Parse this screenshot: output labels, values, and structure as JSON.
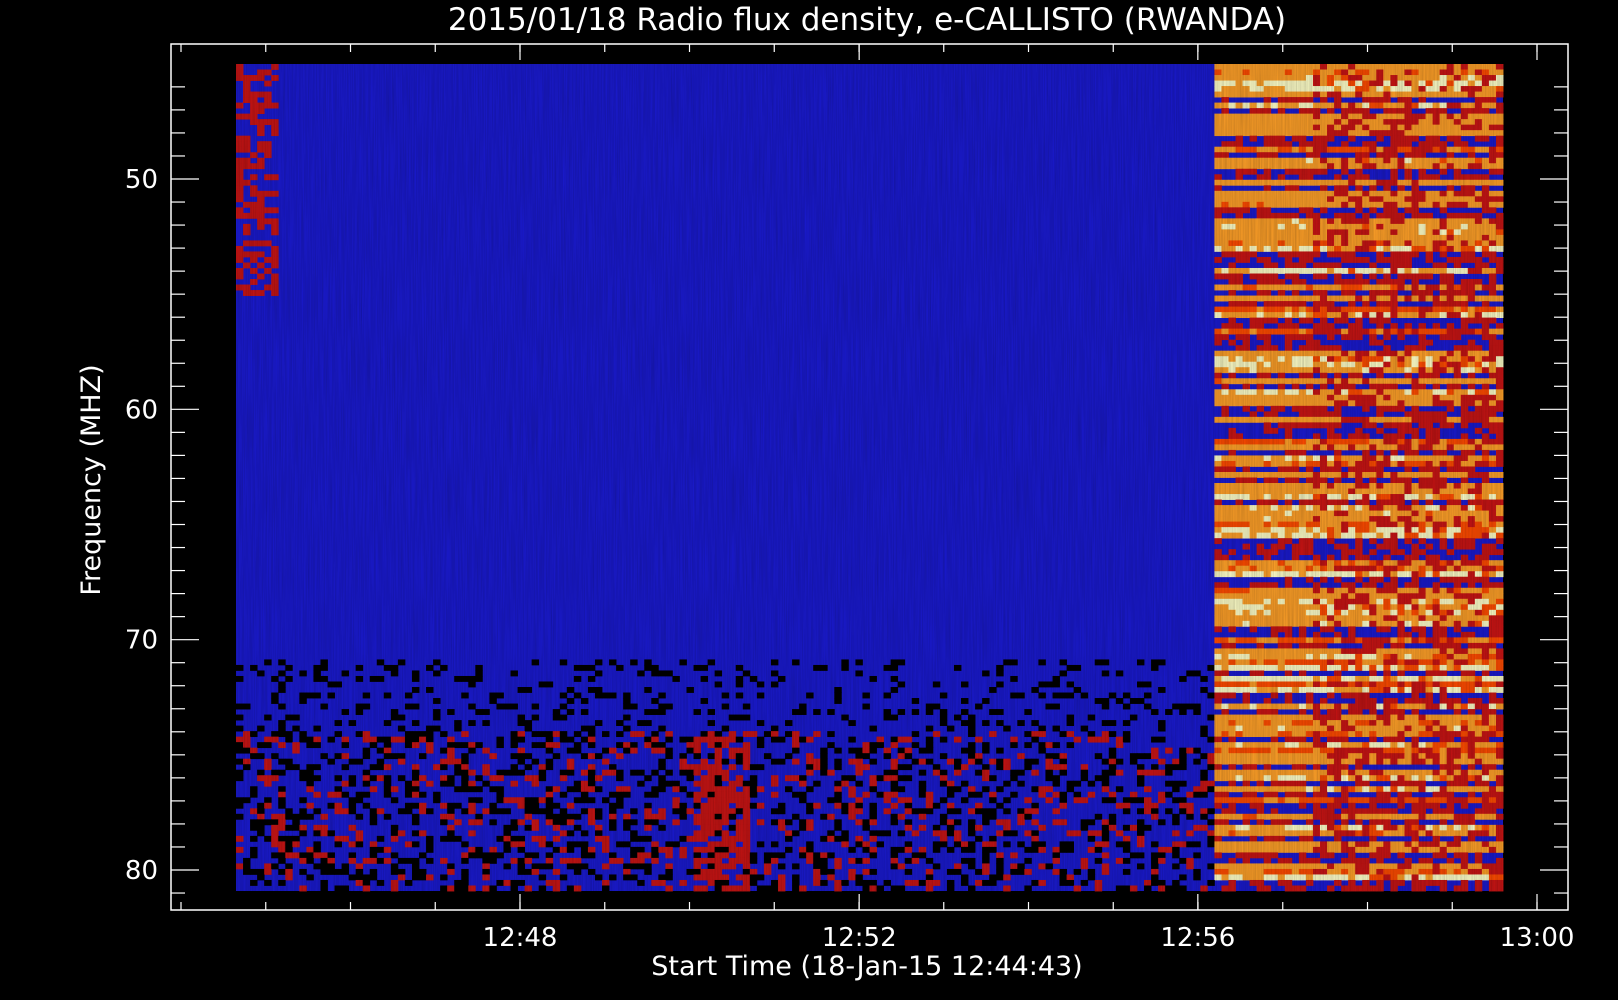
{
  "chart_data": {
    "type": "heatmap",
    "title": "2015/01/18  Radio flux density, e-CALLISTO (RWANDA)",
    "xlabel": "Start Time (18-Jan-15 12:44:43)",
    "ylabel": "Frequency (MHZ)",
    "x_ticks": [
      {
        "value": 12.8,
        "label": "12:48"
      },
      {
        "value": 12.8667,
        "label": "12:52"
      },
      {
        "value": 12.9333,
        "label": "12:56"
      },
      {
        "value": 13.0,
        "label": "13:00"
      }
    ],
    "y_ticks": [
      {
        "value": 50,
        "label": "50"
      },
      {
        "value": 60,
        "label": "60"
      },
      {
        "value": 70,
        "label": "70"
      },
      {
        "value": 80,
        "label": "80"
      }
    ],
    "x_range": [
      "12:44:43",
      "13:00:08"
    ],
    "y_range_mhz": [
      45,
      81
    ],
    "y_axis_direction": "increasing downward",
    "colormap": [
      "#000000",
      "#1a1ad0",
      "#c81414",
      "#ff4b00",
      "#ffa028",
      "#ffffc8"
    ],
    "features": [
      {
        "kind": "background",
        "freq_mhz": [
          45,
          81
        ],
        "time": [
          "12:44:43",
          "12:56:10"
        ],
        "level": "low"
      },
      {
        "kind": "bright_bands",
        "time": [
          "12:56:10",
          "13:00:08"
        ],
        "freq_mhz": [
          46,
          81
        ],
        "level": "high"
      },
      {
        "kind": "red_patch",
        "time": [
          "12:50:00",
          "12:50:40"
        ],
        "freq_mhz": [
          72,
          81
        ],
        "level": "medium"
      }
    ]
  }
}
